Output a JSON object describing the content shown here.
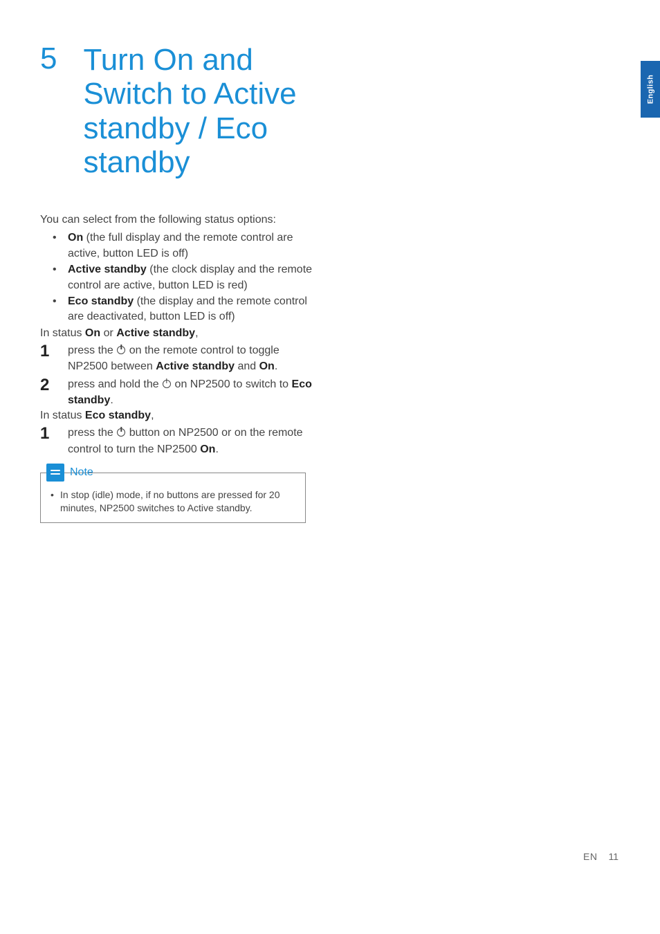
{
  "language_tab": "English",
  "chapter": {
    "number": "5",
    "title": "Turn On and Switch to Active standby / Eco standby"
  },
  "intro": "You can select from the following status options:",
  "status_options": [
    {
      "label": "On",
      "desc": " (the full display and the remote control are active, button LED is off)"
    },
    {
      "label": "Active standby",
      "desc": " (the clock display and the remote control are active, button LED is red)"
    },
    {
      "label": "Eco standby",
      "desc": " (the display and the remote control are deactivated, button LED is off)"
    }
  ],
  "status_on_line_pre": "In status ",
  "status_on_b1": "On",
  "status_on_mid": " or ",
  "status_on_b2": "Active standby",
  "status_on_post": ",",
  "step_on_1": {
    "num": "1",
    "pre": "press the ",
    "mid": " on the remote control to toggle NP2500 between ",
    "b1": "Active standby",
    "and": " and ",
    "b2": "On",
    "post": "."
  },
  "step_on_2": {
    "num": "2",
    "pre": "press and hold the ",
    "mid": " on NP2500 to switch to ",
    "b1": "Eco standby",
    "post": "."
  },
  "status_eco_pre": "In status ",
  "status_eco_b": "Eco standby",
  "status_eco_post": ",",
  "step_eco_1": {
    "num": "1",
    "pre": "press the ",
    "mid": " button on NP2500 or on the remote control to turn the NP2500 ",
    "b1": "On",
    "post": "."
  },
  "note": {
    "label": "Note",
    "text": "In stop (idle) mode, if no buttons are pressed for 20 minutes, NP2500 switches to Active standby."
  },
  "footer": {
    "lang": "EN",
    "page": "11"
  }
}
